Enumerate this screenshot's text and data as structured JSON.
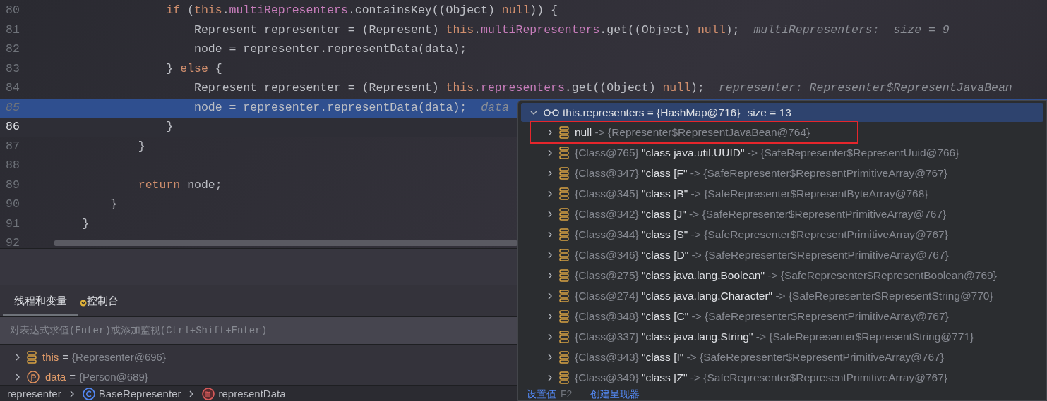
{
  "editor": {
    "lines": [
      {
        "number": "80",
        "execution_point": false,
        "current": false,
        "tokens": [
          {
            "kind": "keyword",
            "text": "                if"
          },
          {
            "kind": "plain",
            "text": " ("
          },
          {
            "kind": "keyword",
            "text": "this"
          },
          {
            "kind": "plain",
            "text": "."
          },
          {
            "kind": "field",
            "text": "multiRepresenters"
          },
          {
            "kind": "plain",
            "text": ".containsKey((Object) "
          },
          {
            "kind": "keyword",
            "text": "null"
          },
          {
            "kind": "plain",
            "text": ")) {"
          }
        ]
      },
      {
        "number": "81",
        "execution_point": false,
        "current": false,
        "tokens": [
          {
            "kind": "plain",
            "text": "                    Represent representer = (Represent) "
          },
          {
            "kind": "keyword",
            "text": "this"
          },
          {
            "kind": "plain",
            "text": "."
          },
          {
            "kind": "field",
            "text": "multiRepresenters"
          },
          {
            "kind": "plain",
            "text": ".get((Object) "
          },
          {
            "kind": "keyword",
            "text": "null"
          },
          {
            "kind": "plain",
            "text": ");"
          },
          {
            "kind": "hint",
            "text": "multiRepresenters:  size = 9"
          }
        ]
      },
      {
        "number": "82",
        "execution_point": false,
        "current": false,
        "tokens": [
          {
            "kind": "plain",
            "text": "                    node = representer.representData(data);"
          }
        ]
      },
      {
        "number": "83",
        "execution_point": false,
        "current": false,
        "tokens": [
          {
            "kind": "plain",
            "text": "                } "
          },
          {
            "kind": "keyword",
            "text": "else"
          },
          {
            "kind": "plain",
            "text": " {"
          }
        ]
      },
      {
        "number": "84",
        "execution_point": false,
        "current": false,
        "tokens": [
          {
            "kind": "plain",
            "text": "                    Represent representer = (Represent) "
          },
          {
            "kind": "keyword",
            "text": "this"
          },
          {
            "kind": "plain",
            "text": "."
          },
          {
            "kind": "field",
            "text": "representers"
          },
          {
            "kind": "plain",
            "text": ".get((Object) "
          },
          {
            "kind": "keyword",
            "text": "null"
          },
          {
            "kind": "plain",
            "text": ");"
          },
          {
            "kind": "hint",
            "text": "representer: Representer$RepresentJavaBean"
          }
        ]
      },
      {
        "number": "85",
        "execution_point": true,
        "current": false,
        "tokens": [
          {
            "kind": "plain",
            "text": "                    node = representer.representData(data);"
          },
          {
            "kind": "hint",
            "text": "data"
          }
        ]
      },
      {
        "number": "86",
        "execution_point": false,
        "current": true,
        "tokens": [
          {
            "kind": "plain",
            "text": "                }"
          }
        ]
      },
      {
        "number": "87",
        "execution_point": false,
        "current": false,
        "tokens": [
          {
            "kind": "plain",
            "text": "            }"
          }
        ]
      },
      {
        "number": "88",
        "execution_point": false,
        "current": false
      },
      {
        "number": "89",
        "execution_point": false,
        "current": false,
        "tokens": [
          {
            "kind": "keyword",
            "text": "            return"
          },
          {
            "kind": "plain",
            "text": " node;"
          }
        ]
      },
      {
        "number": "90",
        "execution_point": false,
        "current": false,
        "tokens": [
          {
            "kind": "plain",
            "text": "        }"
          }
        ]
      },
      {
        "number": "91",
        "execution_point": false,
        "current": false,
        "tokens": [
          {
            "kind": "plain",
            "text": "    }"
          }
        ]
      },
      {
        "number": "92",
        "execution_point": false,
        "current": false
      }
    ]
  },
  "debug_panel": {
    "tabs": [
      {
        "label": "线程和变量",
        "selected": true
      },
      {
        "label": "控制台",
        "selected": false
      }
    ],
    "expression_field": {
      "placeholder": "对表达式求值(Enter)或添加监视(Ctrl+Shift+Enter)"
    },
    "variables": [
      {
        "kind": "field",
        "name": "this",
        "operator": "=",
        "value": "{Representer@696}"
      },
      {
        "kind": "parameter",
        "name": "data",
        "operator": "=",
        "value": "{Person@689}"
      }
    ]
  },
  "breadcrumb": [
    {
      "kind": "text",
      "label": "representer"
    },
    {
      "kind": "class",
      "label": "BaseRepresenter"
    },
    {
      "kind": "method",
      "label": "representData"
    }
  ],
  "popup": {
    "header": {
      "text": "this.representers = {HashMap@716}",
      "size": "size = 13"
    },
    "entries": [
      {
        "key": "null",
        "value": "-> {Representer$RepresentJavaBean@764}",
        "highlighted": true
      },
      {
        "key_ref": "{Class@765}",
        "key": "\"class java.util.UUID\"",
        "value": "-> {SafeRepresenter$RepresentUuid@766}",
        "highlighted": false
      },
      {
        "key_ref": "{Class@347}",
        "key": "\"class [F\"",
        "value": "-> {SafeRepresenter$RepresentPrimitiveArray@767}",
        "highlighted": false
      },
      {
        "key_ref": "{Class@345}",
        "key": "\"class [B\"",
        "value": "-> {SafeRepresenter$RepresentByteArray@768}",
        "highlighted": false
      },
      {
        "key_ref": "{Class@342}",
        "key": "\"class [J\"",
        "value": "-> {SafeRepresenter$RepresentPrimitiveArray@767}",
        "highlighted": false
      },
      {
        "key_ref": "{Class@344}",
        "key": "\"class [S\"",
        "value": "-> {SafeRepresenter$RepresentPrimitiveArray@767}",
        "highlighted": false
      },
      {
        "key_ref": "{Class@346}",
        "key": "\"class [D\"",
        "value": "-> {SafeRepresenter$RepresentPrimitiveArray@767}",
        "highlighted": false
      },
      {
        "key_ref": "{Class@275}",
        "key": "\"class java.lang.Boolean\"",
        "value": "-> {SafeRepresenter$RepresentBoolean@769}",
        "highlighted": false
      },
      {
        "key_ref": "{Class@274}",
        "key": "\"class java.lang.Character\"",
        "value": "-> {SafeRepresenter$RepresentString@770}",
        "highlighted": false
      },
      {
        "key_ref": "{Class@348}",
        "key": "\"class [C\"",
        "value": "-> {SafeRepresenter$RepresentPrimitiveArray@767}",
        "highlighted": false
      },
      {
        "key_ref": "{Class@337}",
        "key": "\"class java.lang.String\"",
        "value": "-> {SafeRepresenter$RepresentString@771}",
        "highlighted": false
      },
      {
        "key_ref": "{Class@343}",
        "key": "\"class [I\"",
        "value": "-> {SafeRepresenter$RepresentPrimitiveArray@767}",
        "highlighted": false
      },
      {
        "key_ref": "{Class@349}",
        "key": "\"class [Z\"",
        "value": "-> {SafeRepresenter$RepresentPrimitiveArray@767}",
        "highlighted": false
      }
    ],
    "footer": [
      {
        "label": "设置值",
        "shortcut": "F2"
      },
      {
        "label": "创建呈现器"
      }
    ]
  }
}
